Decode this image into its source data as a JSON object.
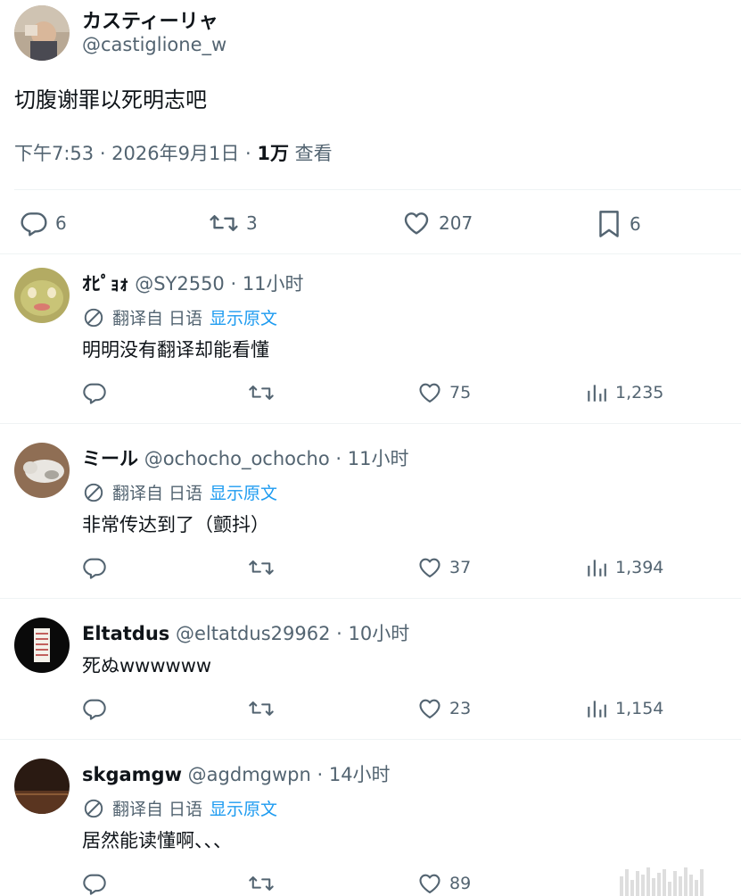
{
  "main_tweet": {
    "display_name": "カスティーリャ",
    "handle": "@castiglione_w",
    "text": "切腹谢罪以死明志吧",
    "time": "下午7:53 · 2026年9月1日 · ",
    "views_count": "1万",
    "views_label": " 查看",
    "actions": {
      "replies": "6",
      "retweets": "3",
      "likes": "207",
      "bookmarks": "6"
    }
  },
  "replies": [
    {
      "display_name": "ｵﾋﾟｮｫ",
      "handle": "@SY2550",
      "time": " · 11小时",
      "translated": true,
      "text": "明明没有翻译却能看懂",
      "likes": "75",
      "views": "1,235"
    },
    {
      "display_name": "ミール",
      "handle": "@ochocho_ochocho",
      "time": " · 11小时",
      "translated": true,
      "text": "非常传达到了（颤抖）",
      "likes": "37",
      "views": "1,394"
    },
    {
      "display_name": "Eltatdus",
      "handle": "@eltatdus29962",
      "time": " · 10小时",
      "translated": false,
      "text": "死ぬwwwwww",
      "likes": "23",
      "views": "1,154"
    },
    {
      "display_name": "skgamgw",
      "handle": "@agdmgwpn",
      "time": " · 14小时",
      "translated": true,
      "text": "居然能读懂啊、、、",
      "likes": "89",
      "views": ""
    }
  ],
  "translation": {
    "label": "翻译自",
    "language": "日语",
    "show_original": "显示原文"
  },
  "colors": {
    "text": "#0f1419",
    "secondary": "#536471",
    "link": "#1d9bf0",
    "divider": "#eff3f4"
  },
  "icons": [
    "reply-icon",
    "retweet-icon",
    "like-icon",
    "bookmark-icon",
    "views-icon",
    "translate-icon"
  ]
}
